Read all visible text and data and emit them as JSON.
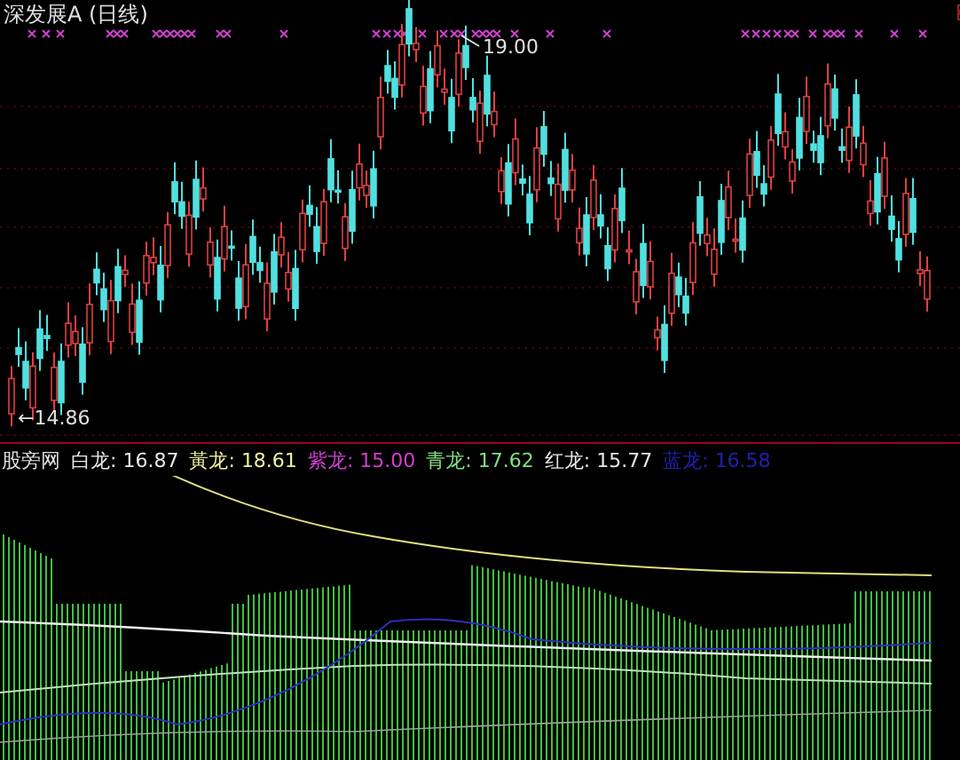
{
  "chart": {
    "title": "深发展A (日线)",
    "high_label": "19.00",
    "low_label": "←14.86"
  },
  "indicator": {
    "name": "股旁网",
    "series": [
      {
        "label": "白龙:",
        "value": "16.87",
        "color": "#e8e8e8"
      },
      {
        "label": "黃龙:",
        "value": "18.61",
        "color": "#f0f0a0"
      },
      {
        "label": "紫龙:",
        "value": "15.00",
        "color": "#d040d0"
      },
      {
        "label": "青龙:",
        "value": "17.62",
        "color": "#80e080"
      },
      {
        "label": "红龙:",
        "value": "15.77",
        "color": "#e8e8e8"
      },
      {
        "label": "蓝龙:",
        "value": "16.58",
        "color": "#2020b0"
      }
    ]
  }
}
